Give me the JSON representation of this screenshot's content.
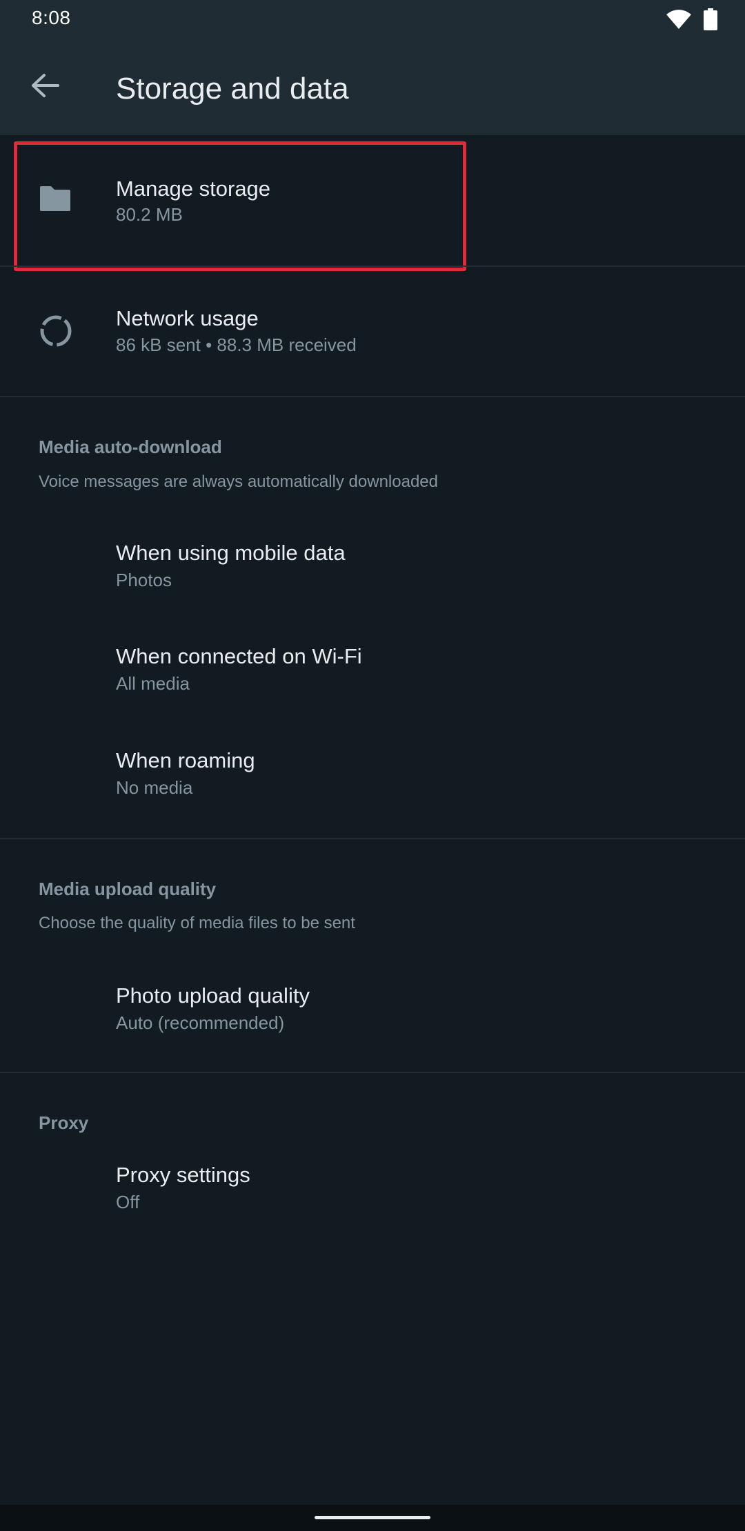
{
  "status_bar": {
    "time": "8:08"
  },
  "header": {
    "title": "Storage and data"
  },
  "storage": {
    "manage": {
      "title": "Manage storage",
      "subtitle": "80.2 MB"
    },
    "network": {
      "title": "Network usage",
      "subtitle": "86 kB sent • 88.3 MB received"
    }
  },
  "media_auto_download": {
    "header": "Media auto-download",
    "description": "Voice messages are always automatically downloaded",
    "items": [
      {
        "title": "When using mobile data",
        "subtitle": "Photos"
      },
      {
        "title": "When connected on Wi-Fi",
        "subtitle": "All media"
      },
      {
        "title": "When roaming",
        "subtitle": "No media"
      }
    ]
  },
  "media_upload_quality": {
    "header": "Media upload quality",
    "description": "Choose the quality of media files to be sent",
    "items": [
      {
        "title": "Photo upload quality",
        "subtitle": "Auto (recommended)"
      }
    ]
  },
  "proxy": {
    "header": "Proxy",
    "items": [
      {
        "title": "Proxy settings",
        "subtitle": "Off"
      }
    ]
  },
  "colors": {
    "background": "#121b22",
    "app_bar": "#202c33",
    "primary_text": "#e9edef",
    "secondary_text": "#8696a0",
    "highlight": "#e0293a"
  }
}
